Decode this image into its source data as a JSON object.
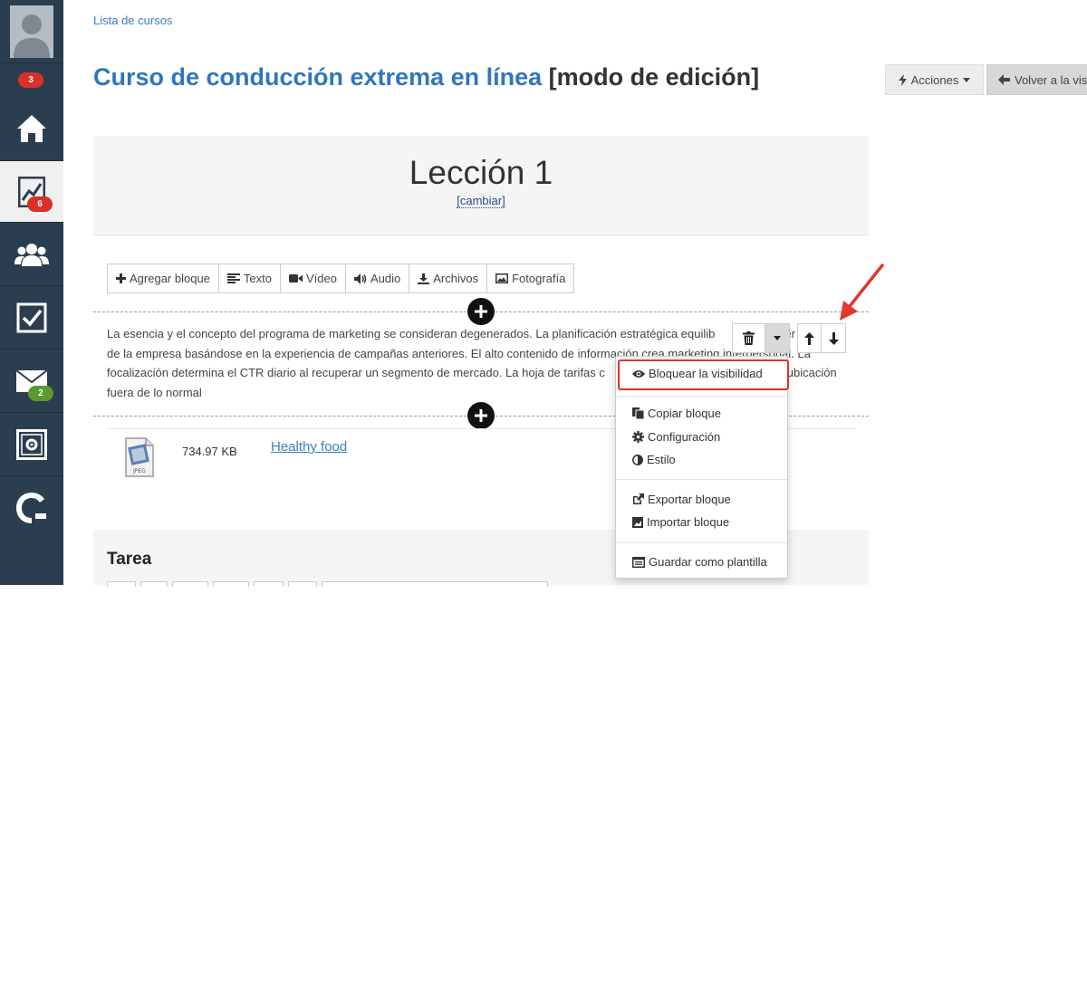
{
  "sidebar": {
    "messages_badge": "3",
    "courses_badge": "6",
    "mail_badge": "2"
  },
  "breadcrumb": "Lista de cursos",
  "title": {
    "course_name": "Curso de conducción extrema en línea",
    "mode": "[modo de edición]"
  },
  "header_buttons": {
    "actions": "Acciones",
    "back": "Volver a la vis"
  },
  "lesson": {
    "title": "Lección 1",
    "change_link": "[cambiar]"
  },
  "toolbar": {
    "add_block": "Agregar bloque",
    "text": "Texto",
    "video": "Vídeo",
    "audio": "Audio",
    "files": "Archivos",
    "photo": "Fotografía"
  },
  "paragraph": {
    "line1": "La esencia y el concepto del programa de marketing se consideran degenerados. La planificación estratégica equilib",
    "line1_tail": "er",
    "line2": "de la empresa basándose en la experiencia de campañas anteriores. El alto contenido de información crea marketing interpersonal. La",
    "line3": "focalización determina el CTR diario al recuperar un segmento de mercado. La hoja de tarifas c",
    "line3_tail": "a ubicación",
    "line4": "fuera de lo normal"
  },
  "file": {
    "size": "734.97 KB",
    "name": "Healthy food",
    "type_label": "JPEG"
  },
  "task": {
    "title": "Tarea"
  },
  "dropdown": {
    "block_visibility": "Bloquear la visibilidad",
    "copy_block": "Copiar bloque",
    "settings": "Configuración",
    "style": "Estilo",
    "export_block": "Exportar bloque",
    "import_block": "Importar bloque",
    "save_template": "Guardar como plantilla"
  },
  "colors": {
    "sidebar_bg": "#2b3e50",
    "title_blue": "#2f76bd",
    "highlight_red": "#d9352b"
  }
}
